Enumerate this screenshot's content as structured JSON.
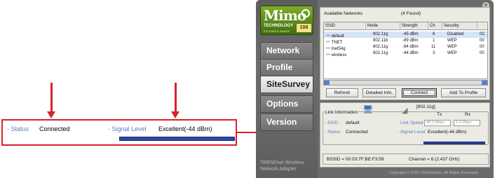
{
  "callout": {
    "status_label": "- Status",
    "status_value": "Connected",
    "signal_label": "- Signal Level",
    "signal_value": "Excellent(-44 dBm)",
    "signal_level_fraction": 0.98
  },
  "app": {
    "logo": {
      "main": "Mimo",
      "sub1": "TECHNOLOGY",
      "sub2": "EXTENDED RANGE",
      "badge": "108"
    },
    "nav": [
      "Network",
      "Profile",
      "SiteSurvey",
      "Options",
      "Version"
    ],
    "active_nav": "SiteSurvey",
    "footer_brand_line1": "TRENDnet Wireless",
    "footer_brand_line2": "Network Adapter",
    "copyright": "Copyright © 2005 TRENDware. All Rights Reserved.",
    "available_networks": {
      "title": "Available Networks",
      "found": "(4 Found)",
      "columns": [
        "SSID",
        "Mode",
        "Strength",
        "Ch",
        "Security",
        ""
      ],
      "rows": [
        {
          "ssid": "default",
          "mode": "802.11g",
          "strength": "-45 dBm",
          "ch": "6",
          "security": "Disabled",
          "extra": "0C"
        },
        {
          "ssid": "TNET",
          "mode": "802.11b",
          "strength": "-89 dBm",
          "ch": "1",
          "security": "WEP",
          "extra": "00"
        },
        {
          "ssid": "tnet54g",
          "mode": "802.11g",
          "strength": "-84 dBm",
          "ch": "11",
          "security": "WEP",
          "extra": "00"
        },
        {
          "ssid": "wireless",
          "mode": "802.11g",
          "strength": "-44 dBm",
          "ch": "3",
          "security": "WEP",
          "extra": "00"
        }
      ]
    },
    "buttons": {
      "refresh": "Refresh",
      "detailed_info": "Detailed Info.",
      "connect": "Connect",
      "add_to_profile": "Add To Profile"
    },
    "link_info": {
      "title": "Link Information",
      "mode_tag": "[802.11g]",
      "tx": "Tx",
      "rx": "Rx",
      "ssid_label": "- SSID",
      "ssid_value": "default",
      "status_label": "- Status",
      "status_value": "Connected",
      "link_speed_label": "- Link Speed",
      "tx_rate": "48.0 Mbps",
      "rx_rate": "1.0 Mbps",
      "signal_label": "- Signal Level",
      "signal_value": "Excellent(-44 dBm)",
      "bssid": "BSSID = 00:03:7F:BE:F3:59",
      "channel": "Channel = 6 (2.437 GHz)"
    }
  }
}
